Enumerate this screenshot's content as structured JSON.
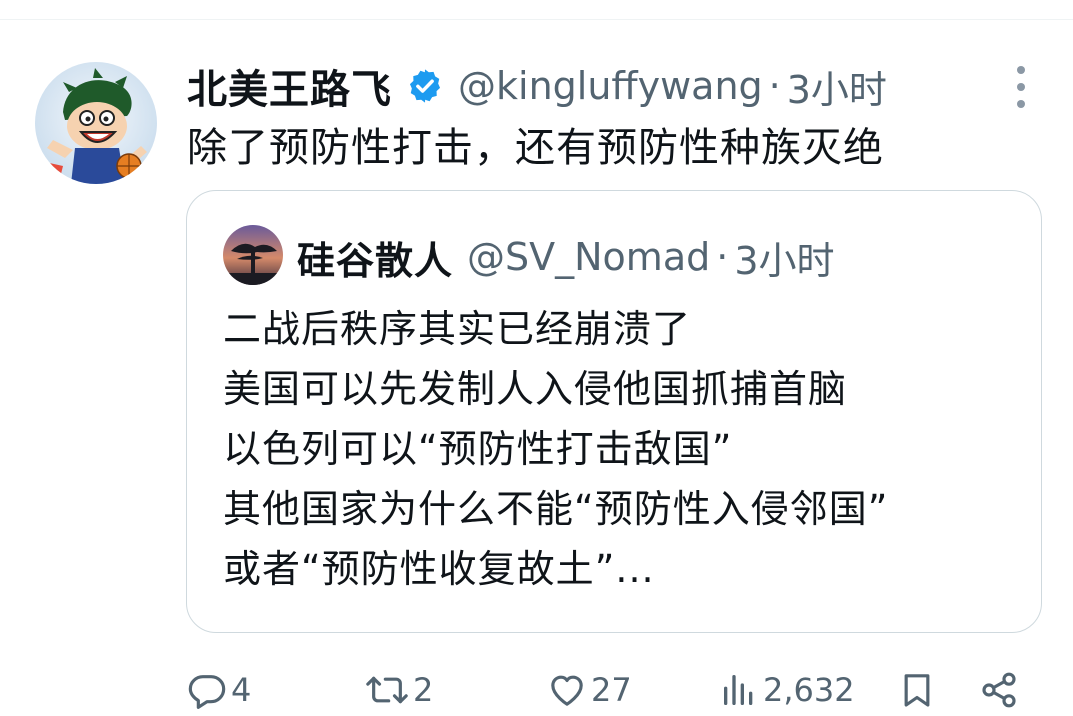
{
  "tweet": {
    "display_name": "北美王路飞",
    "handle": "@kingluffywang",
    "separator": "·",
    "time": "3小时",
    "text": "除了预防性打击，还有预防性种族灭绝"
  },
  "quoted_tweet": {
    "display_name": "硅谷散人",
    "handle": "@SV_Nomad",
    "separator": "·",
    "time": "3小时",
    "lines": [
      "二战后秩序其实已经崩溃了",
      "美国可以先发制人入侵他国抓捕首脑",
      "以色列可以“预防性打击敌国”",
      "其他国家为什么不能“预防性入侵邻国”",
      "或者“预防性收复故土”..."
    ]
  },
  "actions": {
    "replies": "4",
    "reposts": "2",
    "likes": "27",
    "views": "2,632"
  },
  "icons": {
    "verified": "verified-badge-icon",
    "more": "more-options-icon",
    "reply": "reply-icon",
    "repost": "repost-icon",
    "like": "heart-icon",
    "views": "analytics-icon",
    "bookmark": "bookmark-icon",
    "share": "share-icon"
  },
  "colors": {
    "verified_blue": "#1d9bf0",
    "text_primary": "#0f1419",
    "text_secondary": "#536471",
    "border": "#cfd9de"
  }
}
